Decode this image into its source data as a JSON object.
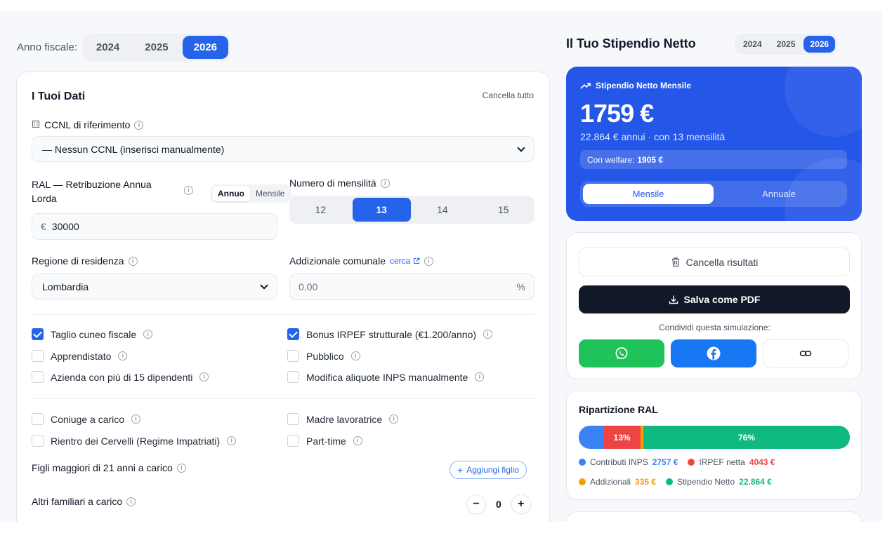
{
  "year_selector": {
    "label": "Anno fiscale:",
    "years": [
      "2024",
      "2025",
      "2026"
    ],
    "active": "2026"
  },
  "data_card": {
    "title": "I Tuoi Dati",
    "clear_all": "Cancella tutto",
    "ccnl": {
      "label": "CCNL di riferimento",
      "value": "— Nessun CCNL (inserisci manualmente)"
    },
    "ral": {
      "label": "RAL — Retribuzione Annua Lorda",
      "toggle": [
        "Annuo",
        "Mensile"
      ],
      "toggle_active": "Annuo",
      "currency": "€",
      "value": "30000"
    },
    "mensilita": {
      "label": "Numero di mensilità",
      "options": [
        "12",
        "13",
        "14",
        "15"
      ],
      "active": "13"
    },
    "regione": {
      "label": "Regione di residenza",
      "value": "Lombardia"
    },
    "addizionale": {
      "label": "Addizionale comunale",
      "link": "cerca",
      "placeholder": "0.00",
      "unit": "%"
    },
    "checks_a": [
      {
        "label": "Taglio cuneo fiscale",
        "checked": true
      },
      {
        "label": "Apprendistato",
        "checked": false
      },
      {
        "label": "Azienda con più di 15 dipendenti",
        "checked": false
      }
    ],
    "checks_b": [
      {
        "label": "Bonus IRPEF strutturale (€1.200/anno)",
        "checked": true
      },
      {
        "label": "Pubblico",
        "checked": false
      },
      {
        "label": "Modifica aliquote INPS manualmente",
        "checked": false
      }
    ],
    "checks_c": [
      {
        "label": "Coniuge a carico",
        "checked": false
      },
      {
        "label": "Rientro dei Cervelli (Regime Impatriati)",
        "checked": false
      }
    ],
    "checks_d": [
      {
        "label": "Madre lavoratrice",
        "checked": false
      },
      {
        "label": "Part-time",
        "checked": false
      }
    ],
    "figli": {
      "label": "Figli maggiori di 21 anni a carico",
      "add_button": "Aggiungi figlio"
    },
    "familiari": {
      "label": "Altri familiari a carico",
      "value": "0",
      "minus": "−",
      "plus": "+"
    }
  },
  "results": {
    "title": "Il Tuo Stipendio Netto",
    "years": [
      "2024",
      "2025",
      "2026"
    ],
    "active_year": "2026",
    "net_card": {
      "header": "Stipendio Netto Mensile",
      "amount": "1759 €",
      "subtitle": "22.864 € annui · con 13 mensilità",
      "welfare_label": "Con welfare:",
      "welfare_value": "1905 €",
      "toggle": [
        "Mensile",
        "Annuale"
      ],
      "toggle_active": "Mensile"
    },
    "actions": {
      "clear": "Cancella risultati",
      "pdf": "Salva come PDF",
      "share_label": "Condividi questa simulazione:"
    },
    "breakdown": {
      "title": "Ripartizione RAL",
      "bar_labels": {
        "irpef": "13%",
        "netto": "76%"
      },
      "shares": {
        "inps": 0.092,
        "irpef": 0.135,
        "addizionali": 0.011,
        "netto": 0.762
      },
      "colors": {
        "inps": "#3b82f6",
        "irpef": "#ef4444",
        "addizionali": "#f59e0b",
        "netto": "#10b981"
      },
      "legend": [
        {
          "label": "Contributi INPS",
          "value": "2757 €",
          "color": "#3b82f6"
        },
        {
          "label": "IRPEF netta",
          "value": "4043 €",
          "color": "#ef4444"
        },
        {
          "label": "Addizionali",
          "value": "335 €",
          "color": "#f59e0b"
        },
        {
          "label": "Stipendio Netto",
          "value": "22.864 €",
          "color": "#10b981"
        }
      ]
    }
  }
}
